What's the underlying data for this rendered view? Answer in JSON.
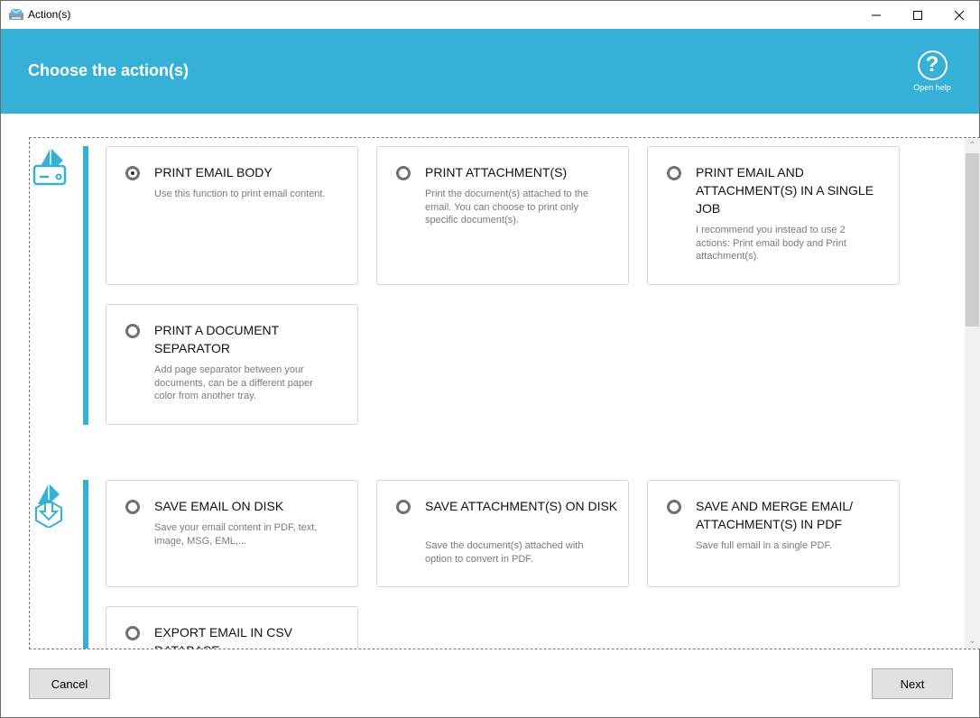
{
  "window": {
    "title": "Action(s)",
    "icon": "email-printer-app-icon",
    "controls": [
      "minimize",
      "maximize",
      "close"
    ]
  },
  "header": {
    "title": "Choose the action(s)",
    "help_label": "Open help",
    "help_icon": "question-circle-icon",
    "color": "#36b0d6"
  },
  "groups": [
    {
      "name": "print",
      "icon": "printer-envelope-icon",
      "actions": [
        {
          "title": "PRINT EMAIL BODY",
          "description": "Use this function to print email content.",
          "selected": true
        },
        {
          "title": "PRINT ATTACHMENT(S)",
          "description": "Print the document(s) attached to the email. You can choose to print only specific document(s).",
          "selected": false
        },
        {
          "title": "PRINT EMAIL AND ATTACHMENT(S) IN A SINGLE JOB",
          "description": "I recommend you instead to use 2 actions: Print email body and Print attachment(s).",
          "selected": false
        },
        {
          "title": "PRINT A DOCUMENT SEPARATOR",
          "description": "Add page separator between your documents, can be a different paper color from another tray.",
          "selected": false
        }
      ]
    },
    {
      "name": "save",
      "icon": "save-download-envelope-icon",
      "actions": [
        {
          "title": "SAVE EMAIL ON DISK",
          "description": "Save your email content in PDF, text, image, MSG, EML,...",
          "selected": false
        },
        {
          "title": "SAVE ATTACHMENT(S) ON DISK",
          "description": "Save the document(s) attached with option to convert in PDF.",
          "selected": false
        },
        {
          "title": "SAVE AND MERGE EMAIL/ ATTACHMENT(S) IN PDF",
          "description": "Save full email in a single PDF.",
          "selected": false
        },
        {
          "title": "EXPORT EMAIL IN CSV DATABASE",
          "description": "",
          "selected": false
        }
      ]
    }
  ],
  "footer": {
    "cancel_label": "Cancel",
    "next_label": "Next"
  }
}
